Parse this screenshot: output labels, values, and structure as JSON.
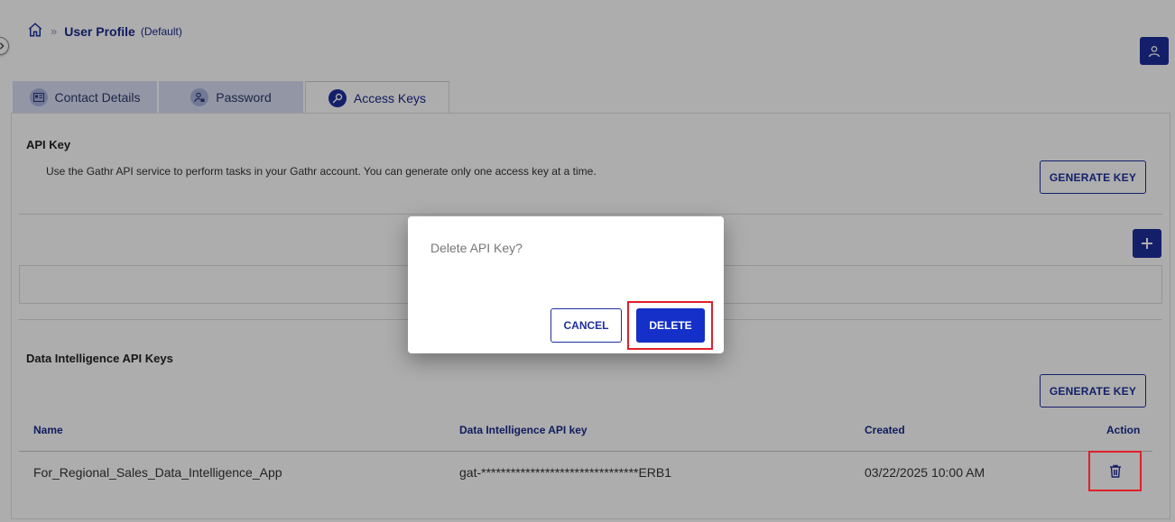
{
  "breadcrumb": {
    "home_icon": "home-icon",
    "separator": "»",
    "title": "User Profile",
    "subtitle": "(Default)"
  },
  "tabs": [
    {
      "label": "Contact Details",
      "icon": "id-card-icon",
      "active": false
    },
    {
      "label": "Password",
      "icon": "user-lock-icon",
      "active": false
    },
    {
      "label": "Access Keys",
      "icon": "key-icon",
      "active": true
    }
  ],
  "api_key_section": {
    "title": "API Key",
    "description": "Use the Gathr API service to perform tasks in your Gathr account. You can generate only one access key at a time.",
    "generate_label": "GENERATE KEY"
  },
  "di_section": {
    "title": "Data Intelligence API Keys",
    "generate_label": "GENERATE KEY",
    "columns": [
      "Name",
      "Data Intelligence API key",
      "Created",
      "Action"
    ],
    "rows": [
      {
        "name": "For_Regional_Sales_Data_Intelligence_App",
        "key": "gat-********************************ERB1",
        "created": "03/22/2025 10:00 AM"
      }
    ]
  },
  "dialog": {
    "message": "Delete API Key?",
    "cancel_label": "CANCEL",
    "delete_label": "DELETE"
  },
  "colors": {
    "primary": "#1e2f9c",
    "delete_button": "#1430c8",
    "highlight": "#e0202a",
    "tab_inactive": "#d9def4"
  }
}
